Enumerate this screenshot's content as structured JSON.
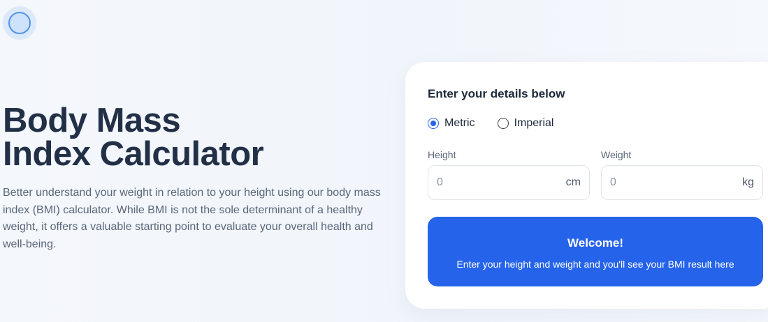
{
  "logo": {
    "icon": "circle-logo-icon"
  },
  "hero": {
    "title_line1": "Body Mass",
    "title_line2": "Index Calculator",
    "description": "Better understand your weight in relation to your height using our body mass index (BMI) calculator. While BMI is not the sole determinant of a healthy weight, it offers a valuable starting point to evaluate your overall health and well-being."
  },
  "form": {
    "title": "Enter your details below",
    "units": [
      {
        "label": "Metric",
        "selected": true
      },
      {
        "label": "Imperial",
        "selected": false
      }
    ],
    "height": {
      "label": "Height",
      "placeholder": "0",
      "unit": "cm"
    },
    "weight": {
      "label": "Weight",
      "placeholder": "0",
      "unit": "kg"
    }
  },
  "result": {
    "title": "Welcome!",
    "text": "Enter your height and weight and you'll see your BMI result here"
  },
  "colors": {
    "accent": "#2563eb",
    "heading": "#223047",
    "body_text": "#5a667a"
  }
}
